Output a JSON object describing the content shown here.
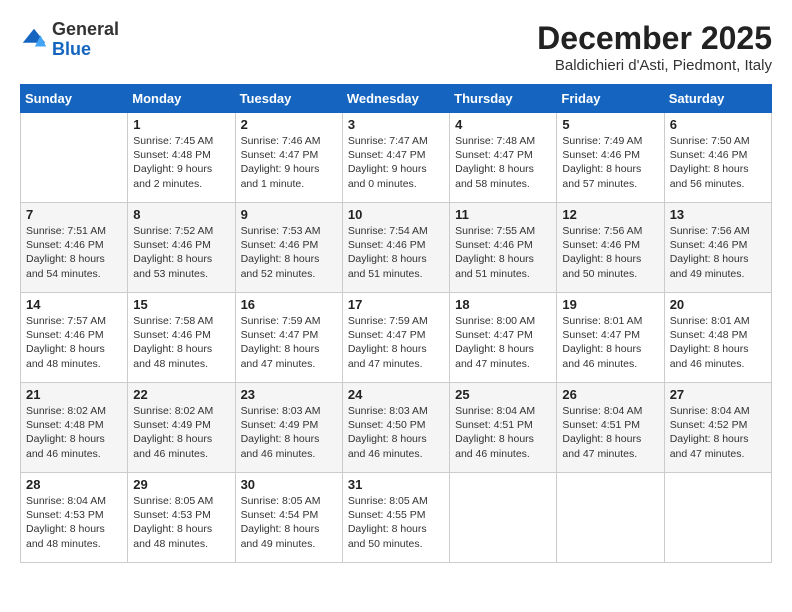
{
  "header": {
    "logo_general": "General",
    "logo_blue": "Blue",
    "month_title": "December 2025",
    "location": "Baldichieri d'Asti, Piedmont, Italy"
  },
  "days_of_week": [
    "Sunday",
    "Monday",
    "Tuesday",
    "Wednesday",
    "Thursday",
    "Friday",
    "Saturday"
  ],
  "weeks": [
    [
      {
        "day": "",
        "sunrise": "",
        "sunset": "",
        "daylight": ""
      },
      {
        "day": "1",
        "sunrise": "Sunrise: 7:45 AM",
        "sunset": "Sunset: 4:48 PM",
        "daylight": "Daylight: 9 hours and 2 minutes."
      },
      {
        "day": "2",
        "sunrise": "Sunrise: 7:46 AM",
        "sunset": "Sunset: 4:47 PM",
        "daylight": "Daylight: 9 hours and 1 minute."
      },
      {
        "day": "3",
        "sunrise": "Sunrise: 7:47 AM",
        "sunset": "Sunset: 4:47 PM",
        "daylight": "Daylight: 9 hours and 0 minutes."
      },
      {
        "day": "4",
        "sunrise": "Sunrise: 7:48 AM",
        "sunset": "Sunset: 4:47 PM",
        "daylight": "Daylight: 8 hours and 58 minutes."
      },
      {
        "day": "5",
        "sunrise": "Sunrise: 7:49 AM",
        "sunset": "Sunset: 4:46 PM",
        "daylight": "Daylight: 8 hours and 57 minutes."
      },
      {
        "day": "6",
        "sunrise": "Sunrise: 7:50 AM",
        "sunset": "Sunset: 4:46 PM",
        "daylight": "Daylight: 8 hours and 56 minutes."
      }
    ],
    [
      {
        "day": "7",
        "sunrise": "Sunrise: 7:51 AM",
        "sunset": "Sunset: 4:46 PM",
        "daylight": "Daylight: 8 hours and 54 minutes."
      },
      {
        "day": "8",
        "sunrise": "Sunrise: 7:52 AM",
        "sunset": "Sunset: 4:46 PM",
        "daylight": "Daylight: 8 hours and 53 minutes."
      },
      {
        "day": "9",
        "sunrise": "Sunrise: 7:53 AM",
        "sunset": "Sunset: 4:46 PM",
        "daylight": "Daylight: 8 hours and 52 minutes."
      },
      {
        "day": "10",
        "sunrise": "Sunrise: 7:54 AM",
        "sunset": "Sunset: 4:46 PM",
        "daylight": "Daylight: 8 hours and 51 minutes."
      },
      {
        "day": "11",
        "sunrise": "Sunrise: 7:55 AM",
        "sunset": "Sunset: 4:46 PM",
        "daylight": "Daylight: 8 hours and 51 minutes."
      },
      {
        "day": "12",
        "sunrise": "Sunrise: 7:56 AM",
        "sunset": "Sunset: 4:46 PM",
        "daylight": "Daylight: 8 hours and 50 minutes."
      },
      {
        "day": "13",
        "sunrise": "Sunrise: 7:56 AM",
        "sunset": "Sunset: 4:46 PM",
        "daylight": "Daylight: 8 hours and 49 minutes."
      }
    ],
    [
      {
        "day": "14",
        "sunrise": "Sunrise: 7:57 AM",
        "sunset": "Sunset: 4:46 PM",
        "daylight": "Daylight: 8 hours and 48 minutes."
      },
      {
        "day": "15",
        "sunrise": "Sunrise: 7:58 AM",
        "sunset": "Sunset: 4:46 PM",
        "daylight": "Daylight: 8 hours and 48 minutes."
      },
      {
        "day": "16",
        "sunrise": "Sunrise: 7:59 AM",
        "sunset": "Sunset: 4:47 PM",
        "daylight": "Daylight: 8 hours and 47 minutes."
      },
      {
        "day": "17",
        "sunrise": "Sunrise: 7:59 AM",
        "sunset": "Sunset: 4:47 PM",
        "daylight": "Daylight: 8 hours and 47 minutes."
      },
      {
        "day": "18",
        "sunrise": "Sunrise: 8:00 AM",
        "sunset": "Sunset: 4:47 PM",
        "daylight": "Daylight: 8 hours and 47 minutes."
      },
      {
        "day": "19",
        "sunrise": "Sunrise: 8:01 AM",
        "sunset": "Sunset: 4:47 PM",
        "daylight": "Daylight: 8 hours and 46 minutes."
      },
      {
        "day": "20",
        "sunrise": "Sunrise: 8:01 AM",
        "sunset": "Sunset: 4:48 PM",
        "daylight": "Daylight: 8 hours and 46 minutes."
      }
    ],
    [
      {
        "day": "21",
        "sunrise": "Sunrise: 8:02 AM",
        "sunset": "Sunset: 4:48 PM",
        "daylight": "Daylight: 8 hours and 46 minutes."
      },
      {
        "day": "22",
        "sunrise": "Sunrise: 8:02 AM",
        "sunset": "Sunset: 4:49 PM",
        "daylight": "Daylight: 8 hours and 46 minutes."
      },
      {
        "day": "23",
        "sunrise": "Sunrise: 8:03 AM",
        "sunset": "Sunset: 4:49 PM",
        "daylight": "Daylight: 8 hours and 46 minutes."
      },
      {
        "day": "24",
        "sunrise": "Sunrise: 8:03 AM",
        "sunset": "Sunset: 4:50 PM",
        "daylight": "Daylight: 8 hours and 46 minutes."
      },
      {
        "day": "25",
        "sunrise": "Sunrise: 8:04 AM",
        "sunset": "Sunset: 4:51 PM",
        "daylight": "Daylight: 8 hours and 46 minutes."
      },
      {
        "day": "26",
        "sunrise": "Sunrise: 8:04 AM",
        "sunset": "Sunset: 4:51 PM",
        "daylight": "Daylight: 8 hours and 47 minutes."
      },
      {
        "day": "27",
        "sunrise": "Sunrise: 8:04 AM",
        "sunset": "Sunset: 4:52 PM",
        "daylight": "Daylight: 8 hours and 47 minutes."
      }
    ],
    [
      {
        "day": "28",
        "sunrise": "Sunrise: 8:04 AM",
        "sunset": "Sunset: 4:53 PM",
        "daylight": "Daylight: 8 hours and 48 minutes."
      },
      {
        "day": "29",
        "sunrise": "Sunrise: 8:05 AM",
        "sunset": "Sunset: 4:53 PM",
        "daylight": "Daylight: 8 hours and 48 minutes."
      },
      {
        "day": "30",
        "sunrise": "Sunrise: 8:05 AM",
        "sunset": "Sunset: 4:54 PM",
        "daylight": "Daylight: 8 hours and 49 minutes."
      },
      {
        "day": "31",
        "sunrise": "Sunrise: 8:05 AM",
        "sunset": "Sunset: 4:55 PM",
        "daylight": "Daylight: 8 hours and 50 minutes."
      },
      {
        "day": "",
        "sunrise": "",
        "sunset": "",
        "daylight": ""
      },
      {
        "day": "",
        "sunrise": "",
        "sunset": "",
        "daylight": ""
      },
      {
        "day": "",
        "sunrise": "",
        "sunset": "",
        "daylight": ""
      }
    ]
  ]
}
